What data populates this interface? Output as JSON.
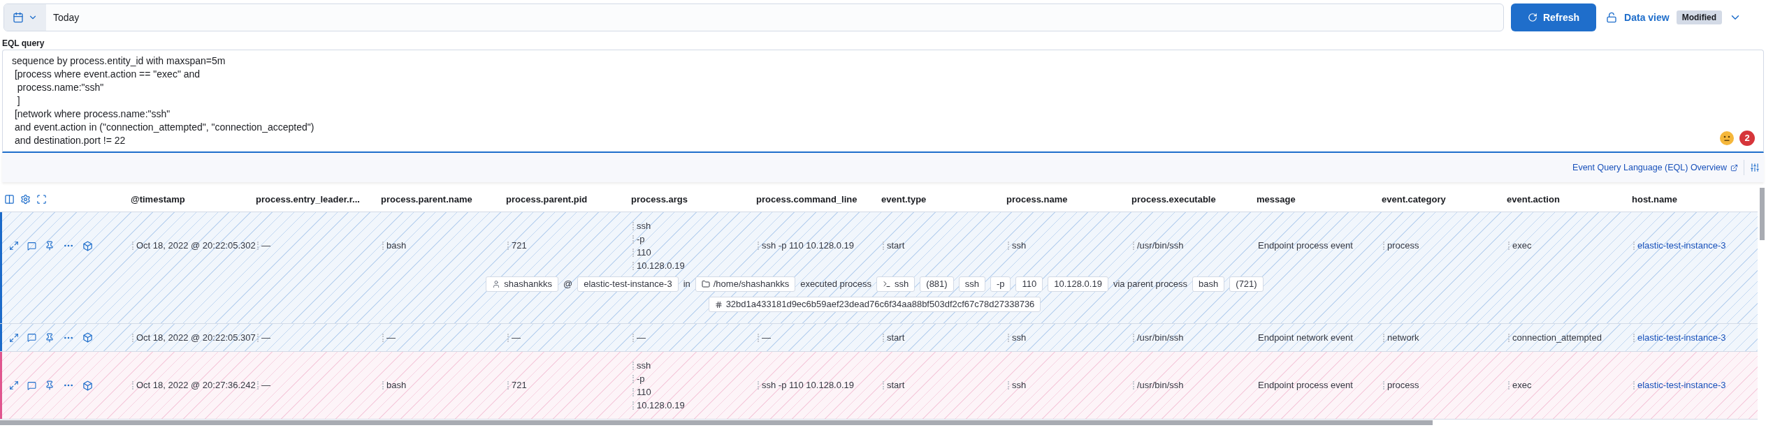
{
  "date_picker": {
    "value": "Today"
  },
  "refresh_button": {
    "label": "Refresh"
  },
  "data_view": {
    "label": "Data view",
    "badge": "Modified"
  },
  "eql_query": {
    "label": "EQL query",
    "lines": [
      "sequence by process.entity_id with maxspan=5m",
      " [process where event.action == \"exec\" and",
      "  process.name:\"ssh\"",
      "  ]",
      " [network where process.name:\"ssh\"",
      " and event.action in (\"connection_attempted\", \"connection_accepted\")",
      " and destination.port != 22"
    ],
    "error_count": "2"
  },
  "footer_link": "Event Query Language (EQL) Overview",
  "table": {
    "columns": [
      {
        "label": "@timestamp",
        "kind": "field"
      },
      {
        "label": "process.entry_leader.r...",
        "kind": "field"
      },
      {
        "label": "process.parent.name",
        "kind": "field"
      },
      {
        "label": "process.parent.pid",
        "kind": "field"
      },
      {
        "label": "process.args",
        "kind": "field"
      },
      {
        "label": "process.command_line",
        "kind": "field"
      },
      {
        "label": "event.type",
        "kind": "field"
      },
      {
        "label": "process.name",
        "kind": "field"
      },
      {
        "label": "process.executable",
        "kind": "field"
      },
      {
        "label": "message",
        "kind": "message"
      },
      {
        "label": "event.category",
        "kind": "field"
      },
      {
        "label": "event.action",
        "kind": "field"
      },
      {
        "label": "host.name",
        "kind": "link"
      }
    ],
    "rows": [
      {
        "color": "#1b6ac9",
        "cells": [
          "Oct 18, 2022 @ 20:22:05.302",
          "—",
          "bash",
          "721",
          [
            "ssh",
            "-p",
            "110",
            "10.128.0.19"
          ],
          "ssh -p 110 10.128.0.19",
          "start",
          "ssh",
          "/usr/bin/ssh",
          "Endpoint process event",
          "process",
          "exec",
          "elastic-test-instance-3"
        ],
        "summary": [
          [
            {
              "kind": "user",
              "text": "shashankks"
            },
            {
              "kind": "text",
              "text": "@"
            },
            {
              "kind": "chip",
              "text": "elastic-test-instance-3"
            },
            {
              "kind": "text",
              "text": "in"
            },
            {
              "kind": "folder",
              "text": "/home/shashankks"
            },
            {
              "kind": "text",
              "text": "executed process"
            },
            {
              "kind": "process",
              "text": "ssh"
            },
            {
              "kind": "chip",
              "text": "(881)"
            },
            {
              "kind": "chip",
              "text": "ssh"
            },
            {
              "kind": "chip",
              "text": "-p"
            },
            {
              "kind": "chip",
              "text": "110"
            },
            {
              "kind": "chip",
              "text": "10.128.0.19"
            },
            {
              "kind": "text",
              "text": "via parent process"
            },
            {
              "kind": "chip",
              "text": "bash"
            },
            {
              "kind": "chip",
              "text": "(721)"
            }
          ],
          [
            {
              "kind": "hash",
              "text": "32bd1a433181d9ec6b59aef23dead76c6f34aa88bf503df2cf67c78d27338736"
            }
          ]
        ]
      },
      {
        "color": "#1b6ac9",
        "cells": [
          "Oct 18, 2022 @ 20:22:05.307",
          "—",
          "—",
          "—",
          "—",
          "—",
          "start",
          "ssh",
          "/usr/bin/ssh",
          "Endpoint network event",
          "network",
          "connection_attempted",
          "elastic-test-instance-3"
        ]
      },
      {
        "color": "#e0568f",
        "cells": [
          "Oct 18, 2022 @ 20:27:36.242",
          "—",
          "bash",
          "721",
          [
            "ssh",
            "-p",
            "110",
            "10.128.0.19"
          ],
          "ssh -p 110 10.128.0.19",
          "start",
          "ssh",
          "/usr/bin/ssh",
          "Endpoint process event",
          "process",
          "exec",
          "elastic-test-instance-3"
        ]
      }
    ]
  }
}
